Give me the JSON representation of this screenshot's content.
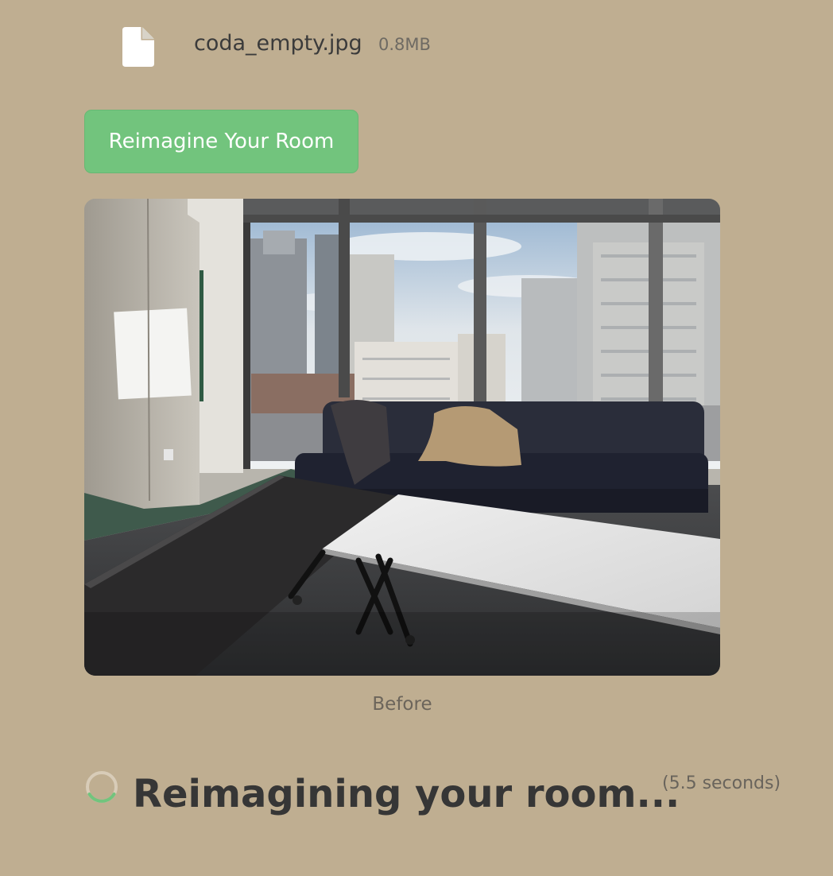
{
  "upload": {
    "icon": "file-icon",
    "file_name": "coda_empty.jpg",
    "file_size": "0.8MB"
  },
  "actions": {
    "reimagine_label": "Reimagine Your Room",
    "button_color": "#72c47d"
  },
  "preview": {
    "caption": "Before"
  },
  "status": {
    "spinner_icon": "spinner-icon",
    "heading": "Reimagining your room...",
    "elapsed": "(5.5 seconds)"
  },
  "colors": {
    "background": "#bfae91",
    "spinner_track": "#d8ccb8",
    "spinner_accent": "#72c47d"
  }
}
